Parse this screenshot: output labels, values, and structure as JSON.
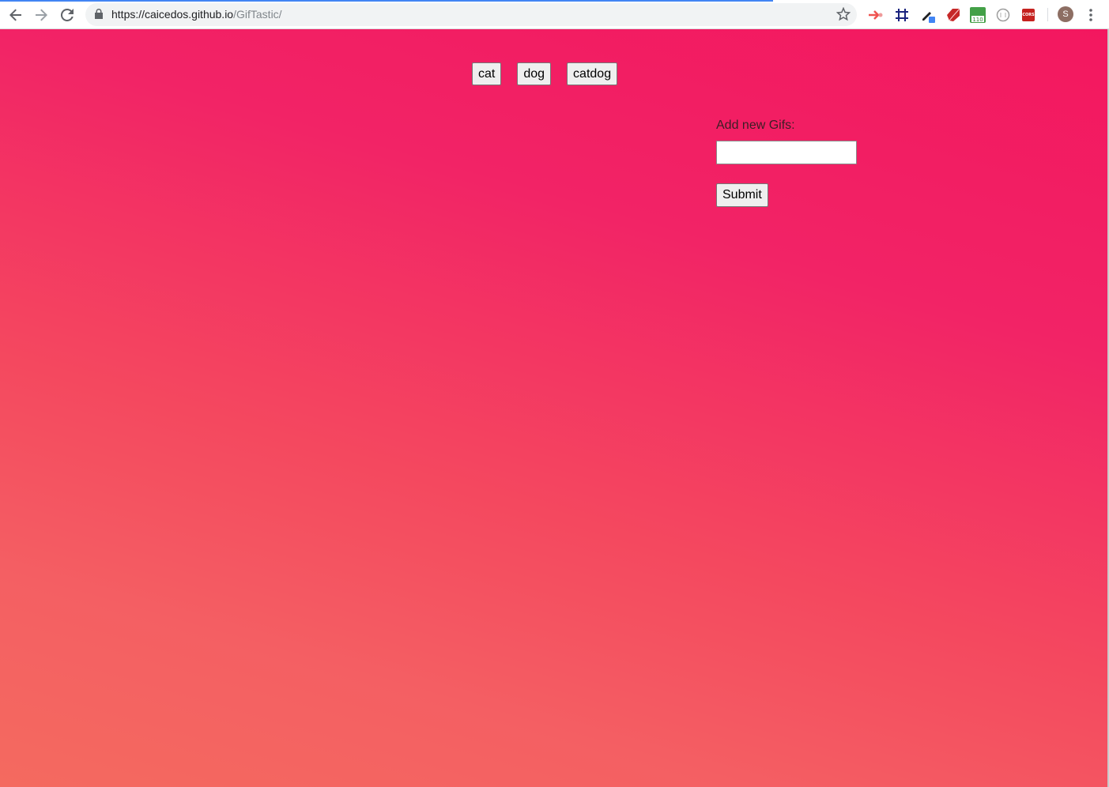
{
  "browser": {
    "url_host": "https://caicedos.github.io",
    "url_path": "/GifTastic/",
    "profile_initial": "S",
    "extensions": [
      {
        "icon": "jump-arrow-icon",
        "color": "#ef5350"
      },
      {
        "icon": "grid-frame-icon",
        "color": "#1a237e"
      },
      {
        "icon": "eyedropper-icon",
        "color": "#202124"
      },
      {
        "icon": "ruby-icon",
        "color": "#c62828"
      },
      {
        "icon": "counter-badge-icon",
        "color": "#43a047",
        "badge_text": "110"
      },
      {
        "icon": "circle-ext-icon",
        "color": "#9e9e9e"
      },
      {
        "icon": "cors-icon",
        "color": "#c5221f",
        "badge_text": "CORS"
      }
    ]
  },
  "page": {
    "topic_buttons": [
      "cat",
      "dog",
      "catdog"
    ],
    "form": {
      "label": "Add new Gifs:",
      "input_value": "",
      "submit_label": "Submit"
    }
  }
}
